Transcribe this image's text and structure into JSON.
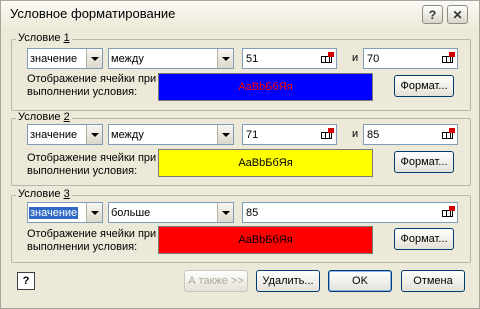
{
  "window": {
    "title": "Условное форматирование",
    "help_symbol": "?",
    "close_symbol": "✕"
  },
  "conditions": [
    {
      "label_prefix": "Условие ",
      "label_num": "1",
      "type_value": "значение",
      "operator_value": "между",
      "value1": "51",
      "and_label": "и",
      "value2": "70",
      "display_label_line1": "Отображение ячейки при",
      "display_label_line2": "выполнении условия:",
      "preview_text": "AaBbБбЯя",
      "preview_bg": "#0000ff",
      "preview_color": "#ff0000",
      "format_button": "Формат..."
    },
    {
      "label_prefix": "Условие ",
      "label_num": "2",
      "type_value": "значение",
      "operator_value": "между",
      "value1": "71",
      "and_label": "и",
      "value2": "85",
      "display_label_line1": "Отображение ячейки при",
      "display_label_line2": "выполнении условия:",
      "preview_text": "AaBbБбЯя",
      "preview_bg": "#ffff00",
      "preview_color": "#000000",
      "format_button": "Формат..."
    },
    {
      "label_prefix": "Условие ",
      "label_num": "3",
      "type_value": "значение",
      "operator_value": "больше",
      "value1": "85",
      "display_label_line1": "Отображение ячейки при",
      "display_label_line2": "выполнении условия:",
      "preview_text": "AaBbБбЯя",
      "preview_bg": "#ff0000",
      "preview_color": "#000000",
      "format_button": "Формат..."
    }
  ],
  "footer": {
    "also_button": "А также >>",
    "delete_button": "Удалить...",
    "ok_button": "OK",
    "cancel_button": "Отмена"
  }
}
